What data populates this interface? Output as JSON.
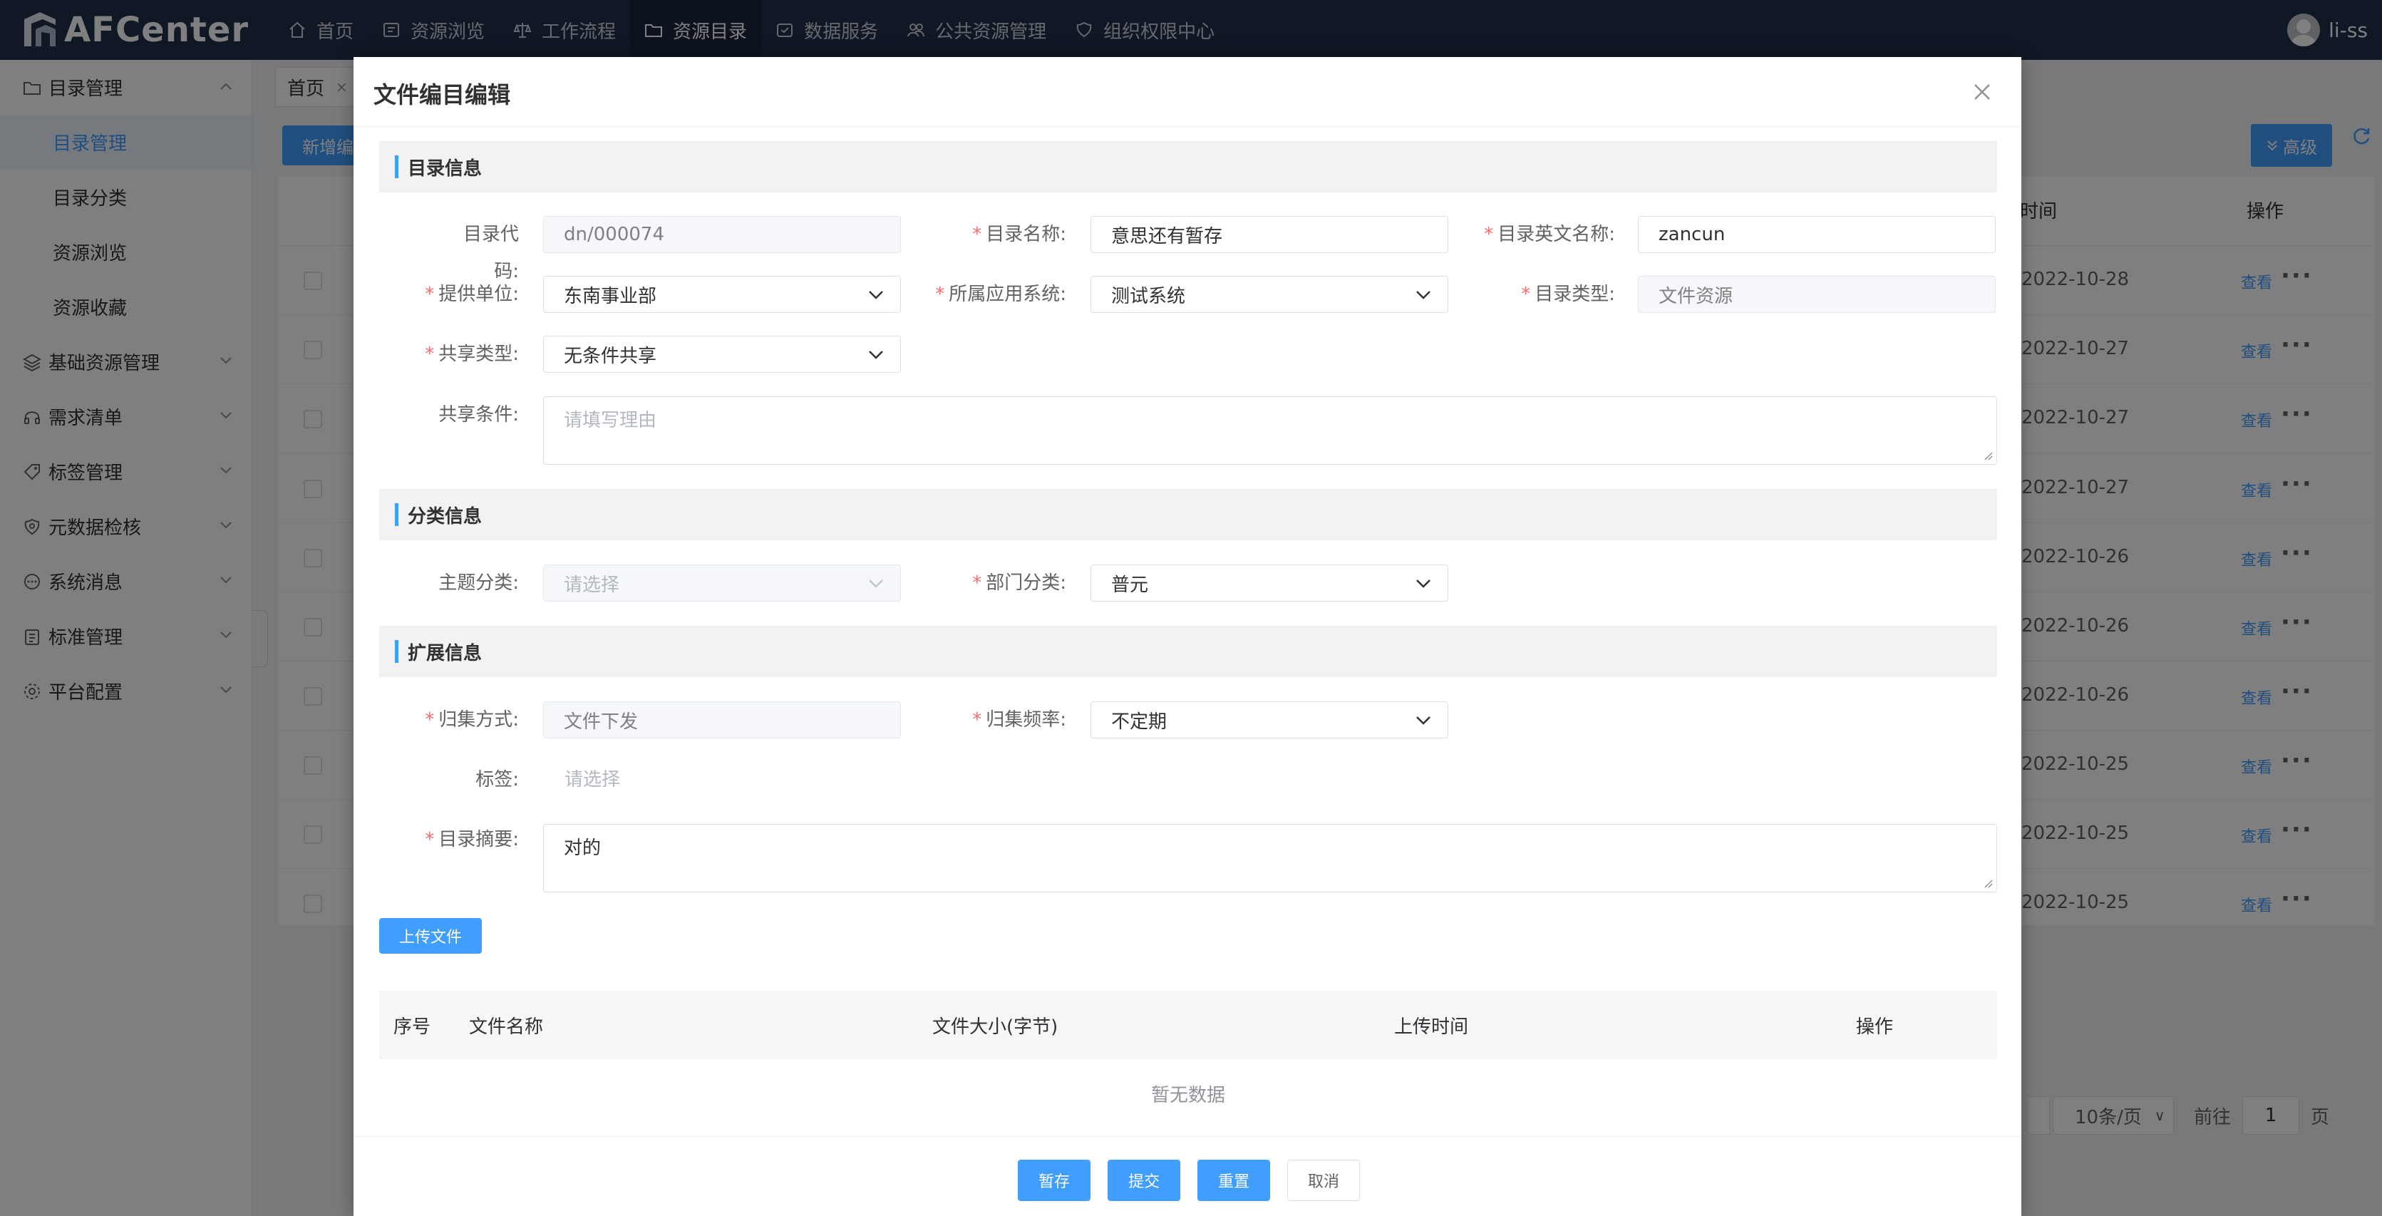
{
  "app": {
    "name": "AFCenter"
  },
  "nav": [
    {
      "label": "首页",
      "icon": "home-icon"
    },
    {
      "label": "资源浏览",
      "icon": "book-icon"
    },
    {
      "label": "工作流程",
      "icon": "balance-icon"
    },
    {
      "label": "资源目录",
      "icon": "folder-icon",
      "active": true
    },
    {
      "label": "数据服务",
      "icon": "service-icon"
    },
    {
      "label": "公共资源管理",
      "icon": "group-icon"
    },
    {
      "label": "组织权限中心",
      "icon": "shield-icon"
    }
  ],
  "user": {
    "name": "li-ss"
  },
  "sidebar": {
    "group_catalog": "目录管理",
    "sub_items": [
      "目录管理",
      "目录分类",
      "资源浏览",
      "资源收藏"
    ],
    "groups": [
      "基础资源管理",
      "需求清单",
      "标签管理",
      "元数据检核",
      "系统消息",
      "标准管理",
      "平台配置"
    ]
  },
  "tabs": {
    "home": "首页",
    "close": "×"
  },
  "toolbar": {
    "new_label": "新增编",
    "advanced_label": "高级"
  },
  "table": {
    "time_header": "时间",
    "op_header": "操作",
    "view_label": "查看",
    "more_label": "···",
    "rows": [
      "2022-10-28",
      "2022-10-27",
      "2022-10-27",
      "2022-10-27",
      "2022-10-26",
      "2022-10-26",
      "2022-10-26",
      "2022-10-25",
      "2022-10-25",
      "2022-10-25"
    ]
  },
  "pager": {
    "page_size": "10条/页",
    "goto": "前往",
    "page": "1",
    "page_unit": "页"
  },
  "dialog": {
    "title": "文件编目编辑",
    "sections": {
      "catalog": "目录信息",
      "category": "分类信息",
      "extend": "扩展信息"
    },
    "labels": {
      "code": "目录代码:",
      "name": "目录名称:",
      "en_name": "目录英文名称:",
      "provider": "提供单位:",
      "app_system": "所属应用系统:",
      "catalog_type": "目录类型:",
      "share_type": "共享类型:",
      "share_cond": "共享条件:",
      "topic": "主题分类:",
      "dept": "部门分类:",
      "collect_mode": "归集方式:",
      "collect_freq": "归集频率:",
      "tags": "标签:",
      "summary": "目录摘要:"
    },
    "values": {
      "code": "dn/000074",
      "name": "意思还有暂存",
      "en_name": "zancun",
      "provider": "东南事业部",
      "app_system": "测试系统",
      "catalog_type": "文件资源",
      "share_type": "无条件共享",
      "share_cond_placeholder": "请填写理由",
      "topic_placeholder": "请选择",
      "dept": "普元",
      "collect_mode": "文件下发",
      "collect_freq": "不定期",
      "tags_placeholder": "请选择",
      "summary": "对的"
    },
    "upload_label": "上传文件",
    "file_table": {
      "headers": [
        "序号",
        "文件名称",
        "文件大小(字节)",
        "上传时间",
        "操作"
      ],
      "empty": "暂无数据"
    },
    "footer": {
      "save": "暂存",
      "submit": "提交",
      "reset": "重置",
      "cancel": "取消"
    }
  },
  "colors": {
    "primary": "#409eff",
    "header_bg": "#1f3048",
    "required": "#f56c6c"
  }
}
